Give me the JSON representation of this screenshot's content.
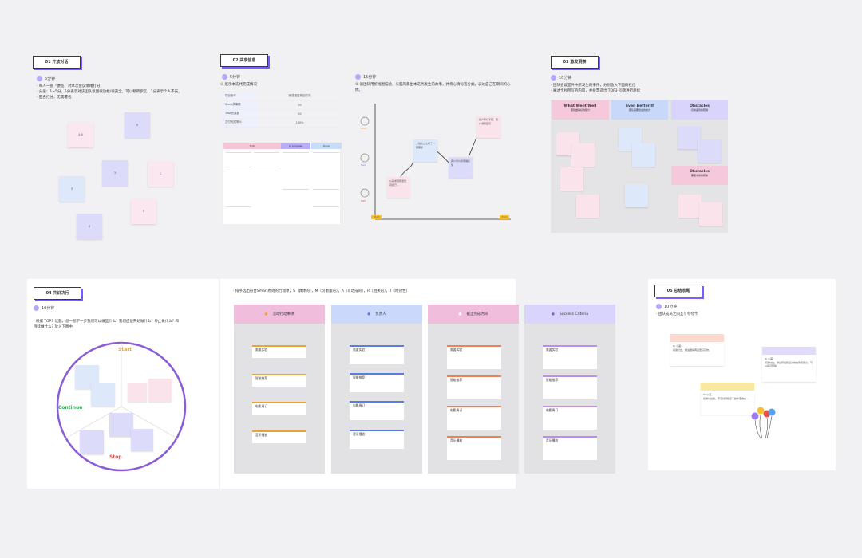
{
  "colors": {
    "accent": "#7b5cff",
    "start": "#f0a030",
    "continue": "#3aaa55",
    "stop": "#e0524a",
    "pink": "#f4c6dc",
    "blue": "#c8d8fa",
    "lav": "#d9d4fb",
    "yellow": "#f8d878"
  },
  "s1": {
    "tag": "01 开放对话",
    "time": "5分钟",
    "lines": [
      "· 每人一张「便签」对本次会议情绪打分;",
      "· 分值：1~5分。5分表示对该团队氛围很放松/很安全，可以畅所欲言，1分表示个人不安。",
      "· 匿名打分，无需署名."
    ],
    "notes": [
      "4.6",
      "5",
      "3",
      "3",
      "2",
      "5",
      "4"
    ]
  },
  "s2": {
    "tag": "02 共享信息",
    "time": "5分钟",
    "intro": "① 展示本迭代完成情况",
    "table": [
      [
        "项目版本",
        "完成增量规划方向"
      ],
      [
        "Story故事数",
        "80"
      ],
      [
        "Task完成数",
        "80"
      ],
      [
        "交付完成率%",
        "100%"
      ]
    ],
    "board_heads": [
      "Todo",
      "In progress",
      "Done"
    ],
    "curve_time": "15分钟",
    "curve_intro": "② 请团队用折线图描绘，头脑风暴出本迭代发生的故事，并将心情标签分类，表达自己在期间的心情。",
    "faces": [
      "Glad",
      "Sad",
      "Mad"
    ],
    "axis_start": "Start",
    "axis_end": "End",
    "points": [
      "从需求调研发现问题已...",
      "上线的分支修了一首需求",
      "客户评价和明确反馈",
      "客户评价不错，客户满意度高"
    ]
  },
  "s3": {
    "tag": "03 激发洞察",
    "time": "10分钟",
    "lines": [
      "· 团队会议室件中所发生的事件，分别放入下面的栏位",
      "· 阐述卡片所写的内容，并投票选出 TOP3 问题进行后续"
    ],
    "cols": [
      {
        "title": "What Went Well",
        "sub": "团队做得好的部分"
      },
      {
        "title": "Even Better If",
        "sub": "团队需要改进的地方"
      },
      {
        "title": "Obstacles",
        "sub": "目前遇到的障碍"
      }
    ],
    "obst2": {
      "title": "Obstacles",
      "sub": "需要寻求的帮助"
    }
  },
  "s4": {
    "tag": "04 共识决行",
    "time": "10分钟",
    "lines": [
      "· 根据 TOP3 议题，想一想下一步我们可以做些什么? 我们应该开始做什么? 停止做什么? 和",
      "  持续做什么? 放入下图中"
    ],
    "labels": {
      "start": "Start",
      "continue": "Continue",
      "stop": "Stop"
    },
    "smart": "· 排序选出符合Smart原则的行动项，S（具体的），M（可衡量的），A（可达成的），R（相关的），T（时效性）",
    "cols": [
      {
        "title": "活动行动事项",
        "color": "#f0bedc"
      },
      {
        "title": "负责人",
        "color": "#c9d8fb"
      },
      {
        "title": "截止完成时间",
        "color": "#f0bedc"
      },
      {
        "title": "Success Criteria",
        "color": "#d9d4fb"
      }
    ],
    "items": [
      "需要实验",
      "智能推荐",
      "电影周订",
      "音乐播放"
    ]
  },
  "s5": {
    "tag": "05 总结收尾",
    "time": "10分钟",
    "lines": [
      "· 团队成员之间互写夸夸卡"
    ],
    "kudos": [
      "To 小美：\n感谢付出，推进做得再度更好高效。",
      "To 小美：\n感谢付出，通过开发和设计的热情和努力，可以提高帮助",
      "To 小美：\n感谢付出和，带来创意和点子的中需求全..."
    ]
  }
}
